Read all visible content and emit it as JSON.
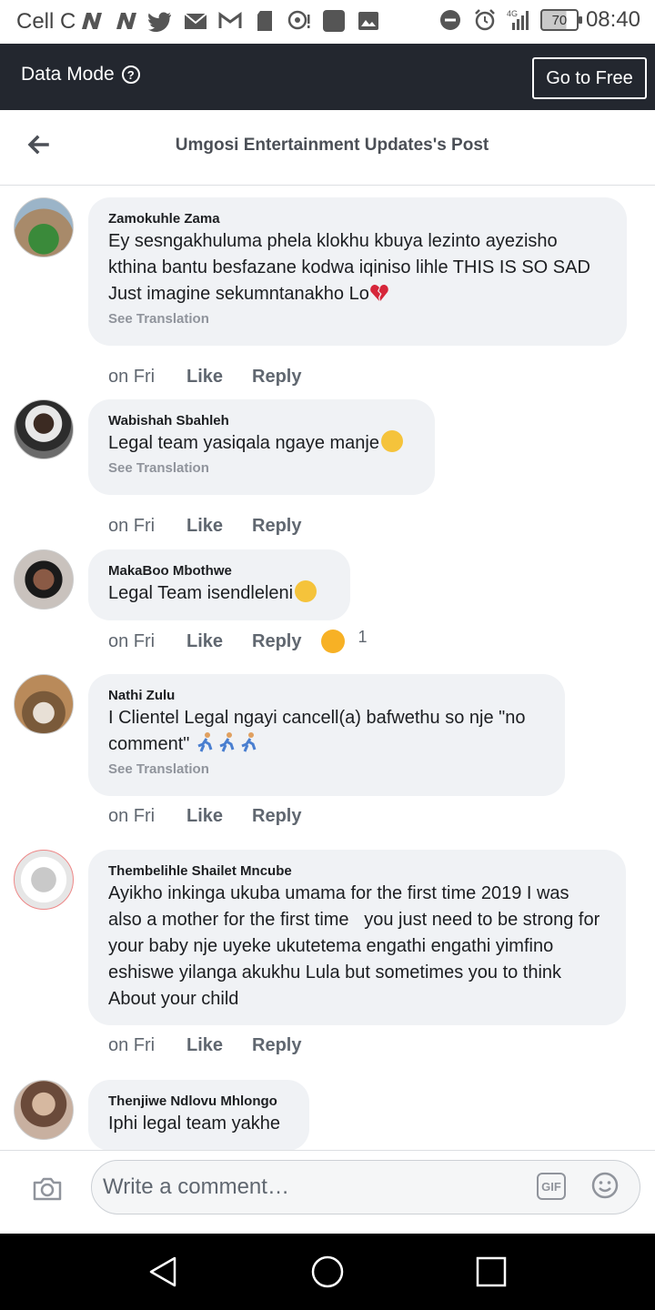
{
  "status_bar": {
    "carrier": "Cell C",
    "battery": "70",
    "network": "4G",
    "time": "08:40"
  },
  "data_bar": {
    "label": "Data Mode",
    "help_glyph": "?",
    "go_free_label": "Go to Free"
  },
  "header": {
    "title": "Umgosi Entertainment Updates's Post"
  },
  "comments": [
    {
      "author": "Zamokuhle Zama",
      "text": "Ey sesngakhuluma phela klokhu kbuya lezinto ayezisho kthina bantu besfazane kodwa iqiniso lihle THIS IS SO SAD Just imagine sekumntanakho Lo",
      "see_translation": "See Translation",
      "time": "on Fri",
      "like": "Like",
      "reply": "Reply"
    },
    {
      "author": "Wabishah Sbahleh",
      "text": "Legal team yasiqala ngaye manje",
      "see_translation": "See Translation",
      "time": "on Fri",
      "like": "Like",
      "reply": "Reply"
    },
    {
      "author": "MakaBoo Mbothwe",
      "text": "Legal Team isendleleni",
      "time": "on Fri",
      "like": "Like",
      "reply": "Reply",
      "reaction_count": "1"
    },
    {
      "author": "Nathi Zulu",
      "text": "I Clientel Legal ngayi cancell(a) bafwethu so nje \"no comment\"",
      "see_translation": "See Translation",
      "time": "on Fri",
      "like": "Like",
      "reply": "Reply"
    },
    {
      "author": "Thembelihle Shailet Mncube",
      "text": "Ayikho inkinga ukuba umama for the first time 2019 I was also a mother for the first time   you just need to be strong for your baby nje uyeke ukutetema engathi engathi yimfino eshiswe yilanga akukhu Lula but sometimes you to think About your child",
      "time": "on Fri",
      "like": "Like",
      "reply": "Reply"
    },
    {
      "author": "Thenjiwe Ndlovu Mhlongo",
      "text": "Iphi legal team yakhe"
    }
  ],
  "compose": {
    "placeholder": "Write a comment…",
    "gif_label": "GIF"
  },
  "colors": {
    "data_bar_bg": "#23272f",
    "bubble_bg": "#f0f2f5",
    "secondary_text": "#606770",
    "nav_bg": "#000000"
  },
  "icons": [
    "back-arrow-icon",
    "help-icon",
    "camera-icon",
    "gif-icon",
    "emoji-icon",
    "nav-back-icon",
    "nav-home-icon",
    "nav-recents-icon"
  ]
}
